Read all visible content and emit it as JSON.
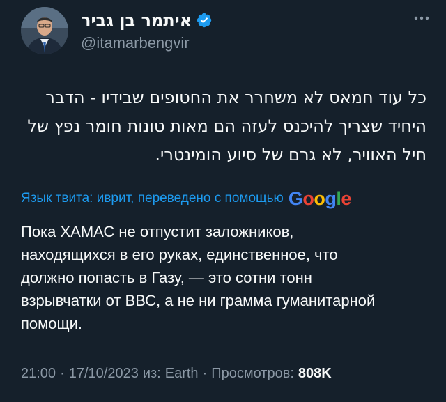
{
  "author": {
    "display_name": "איתמר בן גביר",
    "handle": "@itamarbengvir",
    "verified_icon": "verified-badge-icon",
    "avatar_icon": "profile-photo"
  },
  "menu": {
    "more_icon": "more-options-icon",
    "more_glyph": "···"
  },
  "tweet": {
    "text_lines": [
      "כל עוד חמאס לא משחרר את החטופים שבידיו -  הדבר",
      "היחיד שצריך להיכנס לעזה הם מאות טונות חומר נפץ של",
      "חיל האוויר, לא גרם של סיוע הומינטרי."
    ]
  },
  "translation": {
    "label": "Язык твита: иврит, переведено с помощью",
    "provider": "Google",
    "text_lines": [
      "Пока ХАМАС не отпустит заложников,",
      "находящихся в его руках, единственное, что",
      "должно попасть в Газу, — это сотни тонн",
      "взрывчатки от ВВС, а не ни грамма гуманитарной",
      "помощи."
    ]
  },
  "meta": {
    "time": "21:00",
    "date": "17/10/2023",
    "source_prefix": "из:",
    "source": "Earth",
    "views_label": "Просмотров:",
    "views_count": "808K",
    "separator": "·"
  },
  "colors": {
    "background": "#15202b",
    "text_primary": "#f7f9f9",
    "text_secondary": "#8b98a5",
    "accent": "#1d9bf0"
  }
}
